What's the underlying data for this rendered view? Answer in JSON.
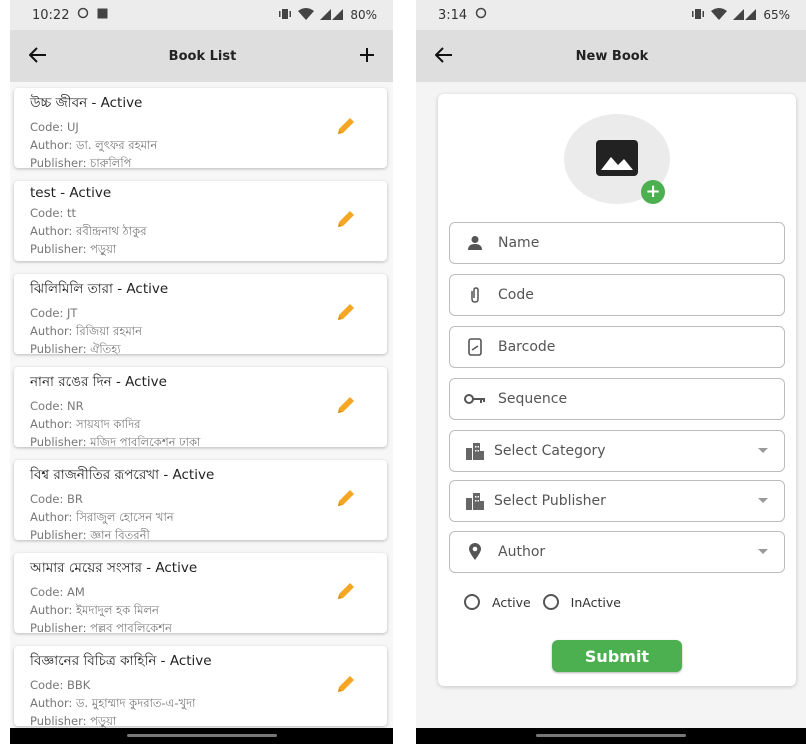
{
  "left": {
    "status": {
      "time": "10:22",
      "battery": "80%"
    },
    "appbar": {
      "title": "Book List"
    },
    "books": [
      {
        "name": "উচ্চ জীবন - Active",
        "code": "Code: UJ",
        "author": "Author: ডা. লুৎফর রহমান",
        "publisher": "Publisher: চারুলিপি"
      },
      {
        "name": "test - Active",
        "code": "Code: tt",
        "author": "Author: রবীন্দ্রনাথ ঠাকুর",
        "publisher": "Publisher: পড়ুয়া"
      },
      {
        "name": "ঝিলিমিলি তারা - Active",
        "code": "Code: JT",
        "author": "Author: রিজিয়া রহমান",
        "publisher": "Publisher: ঐতিহ্য"
      },
      {
        "name": "নানা রঙের দিন - Active",
        "code": "Code: NR",
        "author": "Author: সায়যাদ কাদির",
        "publisher": "Publisher: মজিদ পাবলিকেশন ঢাকা"
      },
      {
        "name": "বিশ্ব রাজনীতির রূপরেখা - Active",
        "code": "Code: BR",
        "author": "Author: সিরাজুল হোসেন খান",
        "publisher": "Publisher: জ্ঞান বিতরনী"
      },
      {
        "name": "আমার মেয়ের সংসার - Active",
        "code": "Code: AM",
        "author": "Author: ইমদাদুল হক মিলন",
        "publisher": "Publisher: পল্লব পাবলিকেশন"
      },
      {
        "name": "বিজ্ঞানের বিচিত্র কাহিনি - Active",
        "code": "Code: BBK",
        "author": "Author: ড. মুহাম্মাদ কুদরাত-এ-খুদা",
        "publisher": "Publisher: পড়ুয়া"
      }
    ]
  },
  "right": {
    "status": {
      "time": "3:14",
      "battery": "65%"
    },
    "appbar": {
      "title": "New Book"
    },
    "fields": {
      "name": "Name",
      "code": "Code",
      "barcode": "Barcode",
      "sequence": "Sequence",
      "category": "Select Category",
      "publisher": "Select Publisher",
      "author": "Author"
    },
    "radio": {
      "active": "Active",
      "inactive": "InActive"
    },
    "submit": "Submit"
  },
  "colors": {
    "accent_green": "#4caf50",
    "edit_orange": "#f5a623"
  },
  "icons": [
    "back-arrow-icon",
    "plus-icon",
    "edit-pencil-icon",
    "image-icon",
    "person-icon",
    "paperclip-icon",
    "barcode-icon",
    "key-icon",
    "building-icon",
    "location-pin-icon"
  ]
}
